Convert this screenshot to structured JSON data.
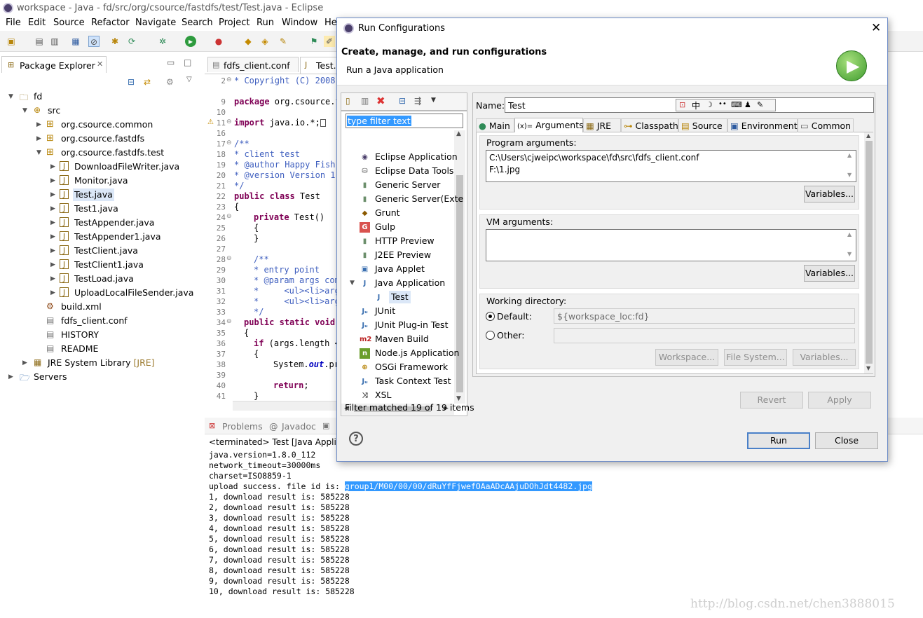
{
  "window": {
    "title": "workspace - Java - fd/src/org/csource/fastdfs/test/Test.java - Eclipse"
  },
  "menu": [
    "File",
    "Edit",
    "Source",
    "Refactor",
    "Navigate",
    "Search",
    "Project",
    "Run",
    "Window",
    "He"
  ],
  "package_explorer": {
    "tab_label": "Package Explorer",
    "items": [
      {
        "label": "fd"
      },
      {
        "label": "src"
      },
      {
        "label": "org.csource.common"
      },
      {
        "label": "org.csource.fastdfs"
      },
      {
        "label": "org.csource.fastdfs.test"
      },
      {
        "label": "DownloadFileWriter.java"
      },
      {
        "label": "Monitor.java"
      },
      {
        "label": "Test.java"
      },
      {
        "label": "Test1.java"
      },
      {
        "label": "TestAppender.java"
      },
      {
        "label": "TestAppender1.java"
      },
      {
        "label": "TestClient.java"
      },
      {
        "label": "TestClient1.java"
      },
      {
        "label": "TestLoad.java"
      },
      {
        "label": "UploadLocalFileSender.java"
      },
      {
        "label": "build.xml"
      },
      {
        "label": "fdfs_client.conf"
      },
      {
        "label": "HISTORY"
      },
      {
        "label": "README"
      },
      {
        "label": "JRE System Library",
        "suffix": "[JRE]"
      },
      {
        "label": "Servers"
      }
    ]
  },
  "editor": {
    "tabs": [
      "fdfs_client.conf",
      "Test."
    ],
    "line_numbers": [
      "2",
      "9",
      "10",
      "11",
      "16",
      "17",
      "18",
      "19",
      "20",
      "21",
      "22",
      "23",
      "24",
      "25",
      "26",
      "27",
      "28",
      "29",
      "30",
      "31",
      "32",
      "33",
      "34",
      "35",
      "36",
      "37",
      "38",
      "39",
      "40",
      "41"
    ],
    "code": {
      "l2": "* Copyright (C) 2008",
      "l9": "package org.csource.f",
      "l11": "import java.io.*;",
      "l17": "/**",
      "l18": "* client test",
      "l19": "* @author Happy Fish",
      "l20": "* @version Version 1.",
      "l21": "*/",
      "l22a": "public class",
      "l22b": " Test",
      "l23": "{",
      "l24a": "private",
      "l24b": " Test()",
      "l25": "{",
      "l26": "}",
      "l28": "/**",
      "l29": "* entry point",
      "l30": "* @param args com",
      "l31": "*     <ul><li>arg",
      "l32": "*     <ul><li>arg",
      "l33": "*/",
      "l34a": "public static void",
      "l35": "{",
      "l36a": "if",
      "l36b": " (args.length <",
      "l37": "{",
      "l38a": "System.",
      "l38b": "out",
      "l38c": ".pr",
      "l40a": "return",
      "l40b": ";",
      "l41": "}"
    }
  },
  "console": {
    "tabs": [
      "Problems",
      "Javadoc"
    ],
    "status": "<terminated> Test [Java Applica",
    "lines": [
      "java.version=1.8.0_112",
      "network_timeout=30000ms",
      "charset=ISO8859-1"
    ],
    "upload_prefix": "upload success. file id is: ",
    "upload_id": "group1/M00/00/00/dRuYfFjwefOAaADcAAjuDOhJdt4482.jpg",
    "results": [
      "1, download result is: 585228",
      "2, download result is: 585228",
      "3, download result is: 585228",
      "4, download result is: 585228",
      "5, download result is: 585228",
      "6, download result is: 585228",
      "7, download result is: 585228",
      "8, download result is: 585228",
      "9, download result is: 585228",
      "10, download result is: 585228"
    ],
    "watermark": "http://blog.csdn.net/chen3888015"
  },
  "dialog": {
    "title": "Run Configurations",
    "heading": "Create, manage, and run configurations",
    "subheading": "Run a Java application",
    "filter_placeholder": "type filter text",
    "config_types": [
      "Eclipse Application",
      "Eclipse Data Tools",
      "Generic Server",
      "Generic Server(Exte",
      "Grunt",
      "Gulp",
      "HTTP Preview",
      "J2EE Preview",
      "Java Applet",
      "Java Application",
      "Test",
      "JUnit",
      "JUnit Plug-in Test",
      "Maven Build",
      "Node.js Application",
      "OSGi Framework",
      "Task Context Test",
      "XSL"
    ],
    "filter_status": "Filter matched 19 of 19 items",
    "name_label": "Name:",
    "name_value": "Test",
    "ime_char": "中",
    "tabs": [
      "Main",
      "Arguments",
      "JRE",
      "Classpath",
      "Source",
      "Environment",
      "Common"
    ],
    "program_args_label": "Program arguments:",
    "program_args": [
      "C:\\Users\\cjweipc\\workspace\\fd\\src\\fdfs_client.conf",
      "F:\\1.jpg"
    ],
    "vm_args_label": "VM arguments:",
    "variables_label": "Variables...",
    "working_dir_label": "Working directory:",
    "default_label": "Default:",
    "default_value": "${workspace_loc:fd}",
    "other_label": "Other:",
    "workspace_btn": "Workspace...",
    "filesystem_btn": "File System...",
    "revert_label": "Revert",
    "apply_label": "Apply",
    "run_label": "Run",
    "close_label": "Close"
  }
}
